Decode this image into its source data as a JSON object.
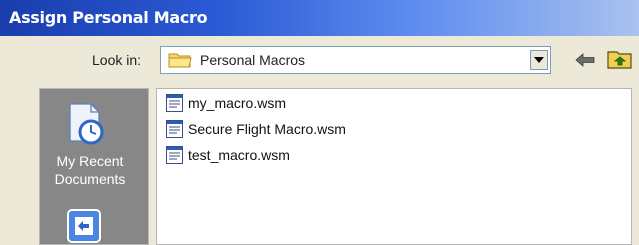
{
  "window": {
    "title": "Assign Personal Macro"
  },
  "lookin": {
    "label": "Look in:",
    "value": "Personal Macros",
    "icon": "folder-icon"
  },
  "toolbar": {
    "back_icon": "back-arrow-icon",
    "up_icon": "up-one-level-folder-icon"
  },
  "places": {
    "items": [
      {
        "label_line1": "My Recent",
        "label_line2": "Documents",
        "icon": "recent-documents-icon"
      },
      {
        "icon": "desktop-icon"
      }
    ]
  },
  "files": [
    {
      "name": "my_macro.wsm",
      "icon": "macro-file-icon"
    },
    {
      "name": "Secure Flight Macro.wsm",
      "icon": "macro-file-icon"
    },
    {
      "name": "test_macro.wsm",
      "icon": "macro-file-icon"
    }
  ],
  "colors": {
    "title_bar_start": "#1a3dad",
    "title_bar_end": "#a9c2ee",
    "dialog_bg": "#ece9d8",
    "places_bar_bg": "#878787"
  }
}
